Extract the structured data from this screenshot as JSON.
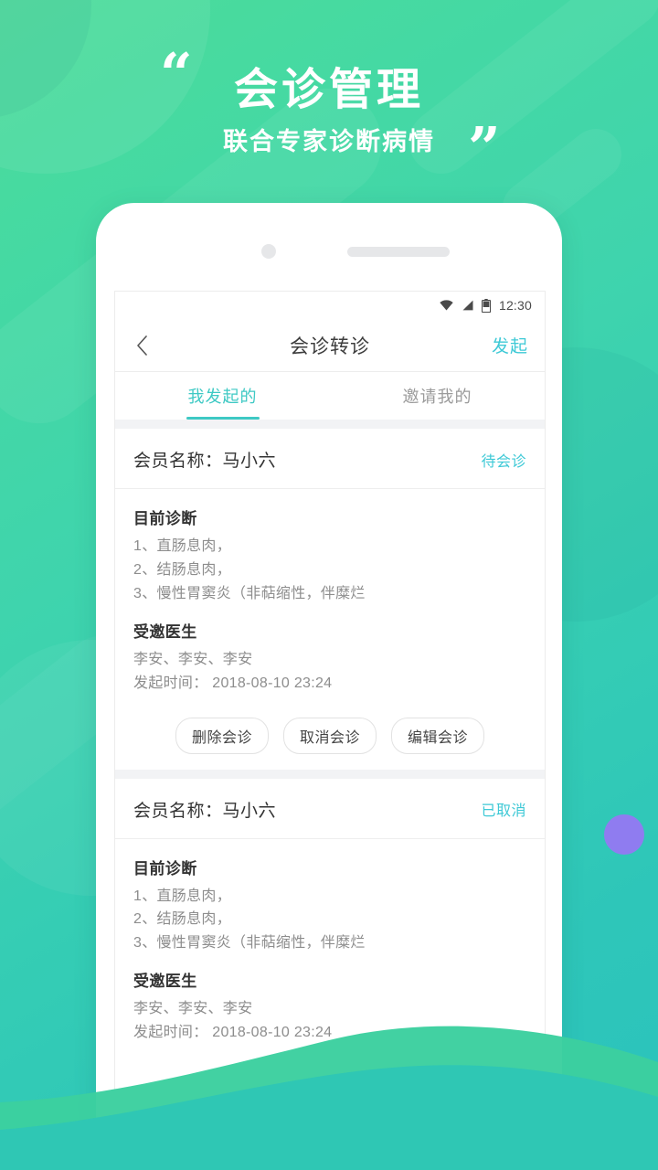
{
  "banner": {
    "quote_open": "“",
    "quote_close": "”",
    "title": "会诊管理",
    "subtitle": "联合专家诊断病情"
  },
  "statusbar": {
    "time": "12:30",
    "wifi_icon": "wifi-icon",
    "signal_icon": "signal-icon",
    "battery_icon": "battery-icon"
  },
  "navbar": {
    "back_icon": "back-chevron-icon",
    "title": "会诊转诊",
    "action_label": "发起"
  },
  "tabs": [
    {
      "label": "我发起的",
      "active": true
    },
    {
      "label": "邀请我的",
      "active": false
    }
  ],
  "cards": [
    {
      "name_label": "会员名称：马小六",
      "status": "待会诊",
      "diagnosis_title": "目前诊断",
      "diagnosis_lines": [
        "1、直肠息肉，",
        "2、结肠息肉，",
        "3、慢性胃窦炎（非萜缩性，伴糜烂"
      ],
      "doctors_title": "受邀医生",
      "doctors": "李安、李安、李安",
      "time_line": "发起时间： 2018-08-10 23:24",
      "actions": [
        "删除会诊",
        "取消会诊",
        "编辑会诊"
      ]
    },
    {
      "name_label": "会员名称：马小六",
      "status": "已取消",
      "diagnosis_title": "目前诊断",
      "diagnosis_lines": [
        "1、直肠息肉，",
        "2、结肠息肉，",
        "3、慢性胃窦炎（非萜缩性，伴糜烂"
      ],
      "doctors_title": "受邀医生",
      "doctors": "李安、李安、李安",
      "time_line": "发起时间： 2018-08-10 23:24",
      "actions": []
    }
  ],
  "colors": {
    "accent_teal": "#3ec9d6",
    "tab_teal": "#3ec9c4",
    "bg_green_start": "#4cdc99",
    "bg_green_end": "#2bc3bd",
    "accent_purple": "#8f7cf0",
    "gap_gray": "#f2f3f5"
  }
}
